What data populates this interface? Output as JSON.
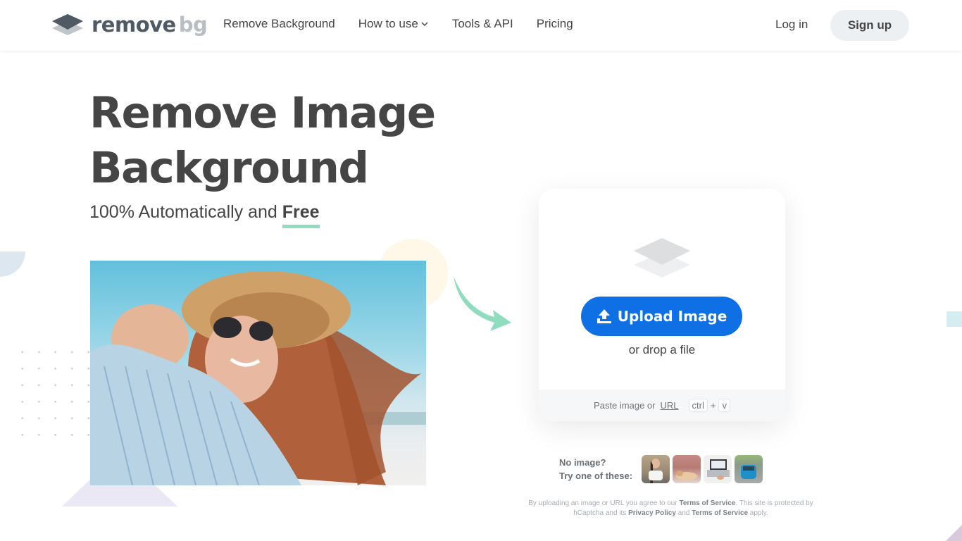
{
  "header": {
    "logo": {
      "word_main": "remove",
      "word_accent": "bg",
      "icon": "layers-logo-icon"
    },
    "nav": [
      {
        "label": "Remove Background"
      },
      {
        "label": "How to use",
        "icon": "chevron-down-icon",
        "has_dropdown": true
      },
      {
        "label": "Tools & API"
      },
      {
        "label": "Pricing"
      }
    ],
    "login_label": "Log in",
    "signup_label": "Sign up"
  },
  "hero": {
    "title_line1": "Remove Image",
    "title_line2": "Background",
    "subtitle_prefix": "100% Automatically and ",
    "subtitle_emphasis": "Free",
    "accent_color": "#8fdcbe"
  },
  "upload": {
    "icon": "layers-placeholder-icon",
    "button_label": "Upload Image",
    "button_icon": "upload-icon",
    "button_color": "#0f70e6",
    "drop_text": "or drop a file",
    "paste_text": "Paste image or",
    "url_link": "URL",
    "kbd_ctrl": "ctrl",
    "kbd_plus": "+",
    "kbd_v": "v"
  },
  "samples": {
    "label_line1": "No image?",
    "label_line2": "Try one of these:",
    "items": [
      {
        "name": "woman-sample"
      },
      {
        "name": "cat-sample"
      },
      {
        "name": "laptop-sample"
      },
      {
        "name": "car-sample"
      }
    ]
  },
  "legal": {
    "part1": "By uploading an image or URL you agree to our ",
    "tos1": "Terms of Service",
    "part2": ". This site is protected by hCaptcha and its ",
    "privacy": "Privacy Policy",
    "part3": " and ",
    "tos2": "Terms of Service",
    "part4": " apply."
  }
}
